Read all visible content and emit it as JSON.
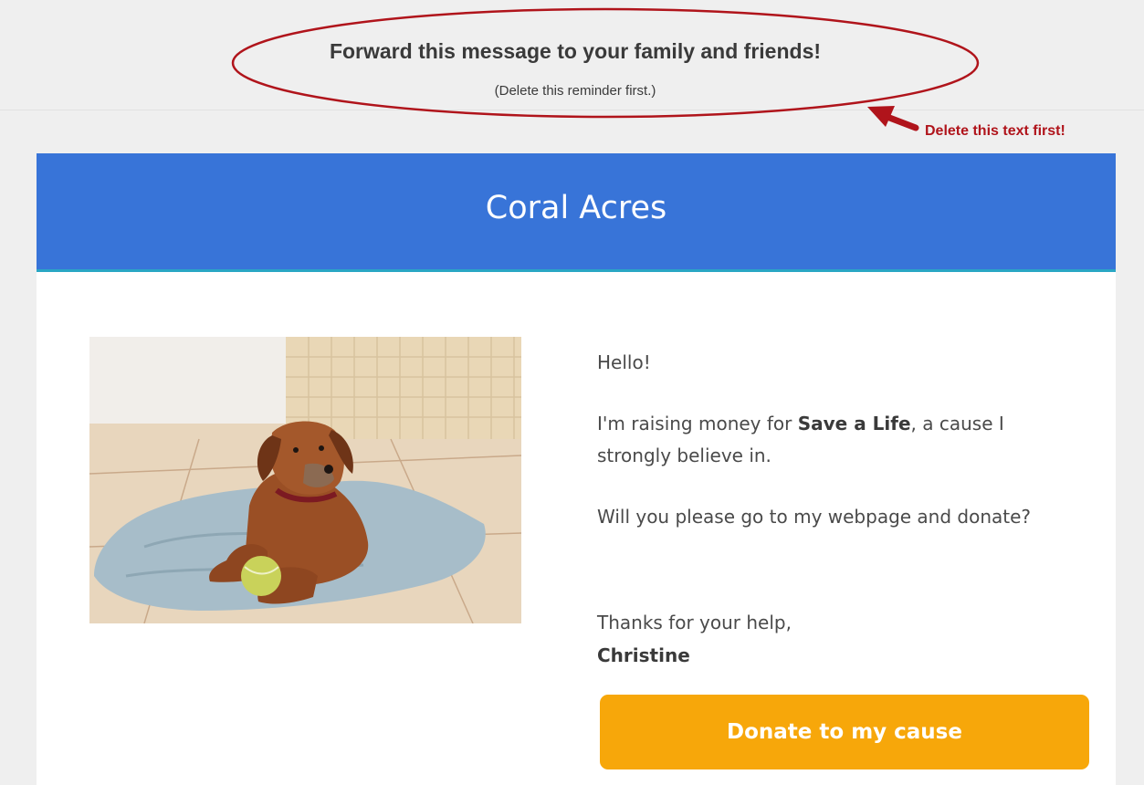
{
  "reminder": {
    "title": "Forward this message to your family and friends!",
    "subtitle": "(Delete this reminder first.)",
    "annotation": "Delete this text first!"
  },
  "email": {
    "header_title": "Coral Acres",
    "greeting": "Hello!",
    "p1_before": "I'm raising money for ",
    "p1_cause": "Save a Life",
    "p1_after": ", a cause I strongly believe in.",
    "p2": "Will you please go to my webpage and donate?",
    "closing": "Thanks for your help,",
    "signature": "Christine",
    "donate_label": "Donate to my cause"
  },
  "colors": {
    "header_bg": "#3874d8",
    "button_bg": "#f7a70a",
    "annotation_red": "#b0141b"
  },
  "icons": {
    "annotation_arrow": "arrow-left-up-icon",
    "annotation_ellipse": "highlight-ellipse"
  }
}
